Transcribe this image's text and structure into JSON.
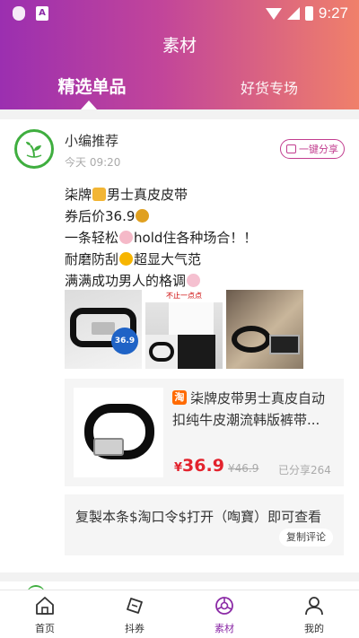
{
  "status_bar": {
    "time": "9:27"
  },
  "header": {
    "title": "素材",
    "tabs": [
      {
        "label": "精选单品",
        "active": true
      },
      {
        "label": "好货专场",
        "active": false
      }
    ]
  },
  "post": {
    "author": "小编推荐",
    "time": "今天 09:20",
    "share_button": "一键分享",
    "lines": [
      "柒牌",
      "男士真皮皮带",
      "券后价36.9",
      "一条轻松",
      "hold住各种场合！！",
      "耐磨防刮",
      "超显大气范",
      "满满成功男人的格调"
    ],
    "images": [
      {
        "name": "belt-photo-1",
        "badge": "36.9"
      },
      {
        "name": "belt-photo-2",
        "caption": "不止一点点"
      },
      {
        "name": "belt-photo-3"
      }
    ],
    "product": {
      "title": "柒牌皮带男士真皮自动扣纯牛皮潮流韩版裤带...",
      "currency": "¥",
      "price": "36.9",
      "original_price": "¥46.9",
      "shared": "已分享264"
    },
    "copy_box": {
      "text": "复製本条$淘口令$打开（啕寶）即可查看",
      "button": "复制评论"
    }
  },
  "bottom_nav": [
    {
      "label": "首页",
      "icon": "home-icon",
      "active": false
    },
    {
      "label": "抖券",
      "icon": "coupon-icon",
      "active": false
    },
    {
      "label": "素材",
      "icon": "material-icon",
      "active": true
    },
    {
      "label": "我的",
      "icon": "profile-icon",
      "active": false
    }
  ],
  "colors": {
    "accent": "#8b2aa6",
    "price": "#e3232d",
    "header_start": "#9b2fb0",
    "header_end": "#f0806a"
  }
}
